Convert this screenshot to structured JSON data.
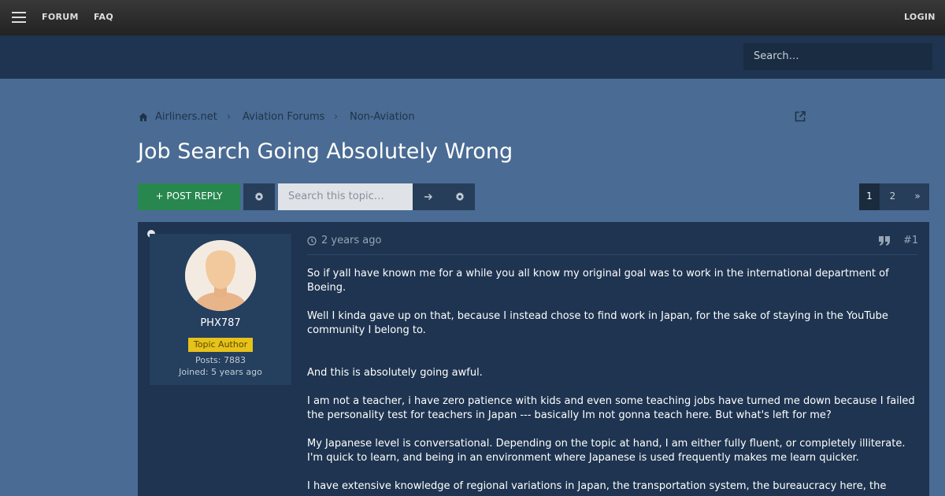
{
  "topbar": {
    "nav": [
      "FORUM",
      "FAQ"
    ],
    "login": "LOGIN"
  },
  "site_search": {
    "placeholder": "Search…"
  },
  "breadcrumb": [
    "Airliners.net",
    "Aviation Forums",
    "Non-Aviation"
  ],
  "topic": {
    "title": "Job Search Going Absolutely Wrong",
    "post_reply": "+ POST REPLY",
    "search_placeholder": "Search this topic…"
  },
  "pagination": {
    "pages": [
      "1",
      "2"
    ],
    "next": "»",
    "current": "1"
  },
  "post": {
    "author": "PHX787",
    "badge": "Topic Author",
    "posts": "Posts: 7883",
    "joined": "Joined: 5 years ago",
    "time": "2 years ago",
    "number": "#1",
    "paragraphs": [
      "So if yall have known me for a while you all know my original goal was to work in the international department of Boeing.",
      "Well I kinda gave up on that, because I instead chose to find work in Japan, for the sake of staying in the YouTube community I belong to.",
      "And this is absolutely going awful.",
      "I am not a teacher, i have zero patience with kids and even some teaching jobs have turned me down because I failed the personality test for teachers in Japan --- basically Im not gonna teach here. But what's left for me?",
      "My Japanese level is conversational. Depending on the topic at hand, I am either fully fluent, or completely illiterate. I'm quick to learn, and being in an environment where Japanese is used frequently makes me learn quicker.",
      "I have extensive knowledge of regional variations in Japan, the transportation system, the bureaucracy here, the"
    ]
  },
  "colors": {
    "page_bg": "#4a6b93",
    "header_bg": "#1e3450",
    "post_reply_green": "#27874e",
    "badge_yellow": "#e6c21a"
  },
  "icons": [
    "menu-icon",
    "home-icon",
    "chevron-right-icon",
    "external-link-icon",
    "gear-icon",
    "arrow-right-icon",
    "clock-icon",
    "quote-icon"
  ]
}
